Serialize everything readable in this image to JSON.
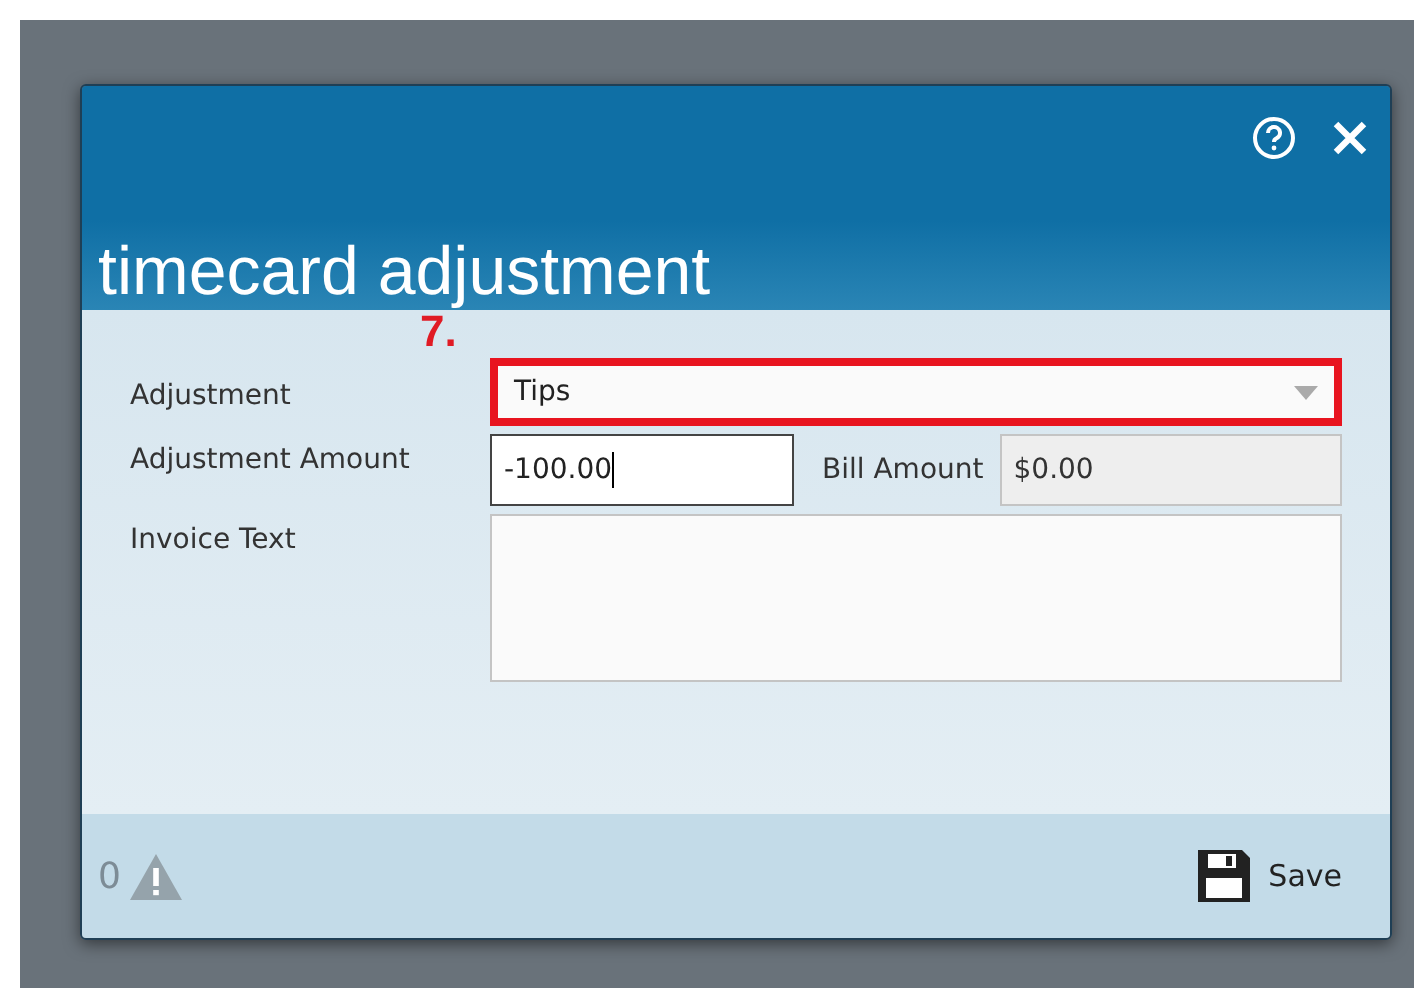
{
  "dialog": {
    "title": "timecard adjustment",
    "header_buttons": [
      {
        "kind": "help"
      },
      {
        "kind": "close"
      }
    ],
    "annotation": "7.",
    "fields": [
      {
        "kind": "dropdown",
        "label": "Adjustment",
        "value": "Tips",
        "highlighted": true
      },
      {
        "kind": "amount",
        "label": "Adjustment Amount",
        "value": "-100.00",
        "focused": true,
        "side_label": "Bill Amount",
        "side_value": "$0.00"
      },
      {
        "kind": "textarea",
        "label": "Invoice Text"
      }
    ],
    "footer": {
      "warning_count": "0",
      "save": "Save"
    }
  }
}
